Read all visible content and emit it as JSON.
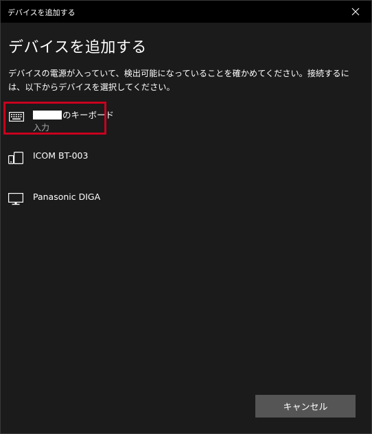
{
  "window": {
    "title": "デバイスを追加する"
  },
  "main": {
    "heading": "デバイスを追加する",
    "description": "デバイスの電源が入っていて、検出可能になっていることを確かめてください。接続するには、以下からデバイスを選択してください。"
  },
  "devices": [
    {
      "name": "のキーボード",
      "subtitle": "入力",
      "icon": "keyboard-icon",
      "selected": true
    },
    {
      "name": "ICOM BT-003",
      "subtitle": "",
      "icon": "phone-device-icon",
      "selected": false
    },
    {
      "name": "Panasonic DIGA",
      "subtitle": "",
      "icon": "monitor-icon",
      "selected": false
    }
  ],
  "footer": {
    "cancel_label": "キャンセル"
  },
  "colors": {
    "background": "#1b1b1b",
    "titlebar": "#000000",
    "selection_border": "#c8001e",
    "button": "#555555"
  }
}
